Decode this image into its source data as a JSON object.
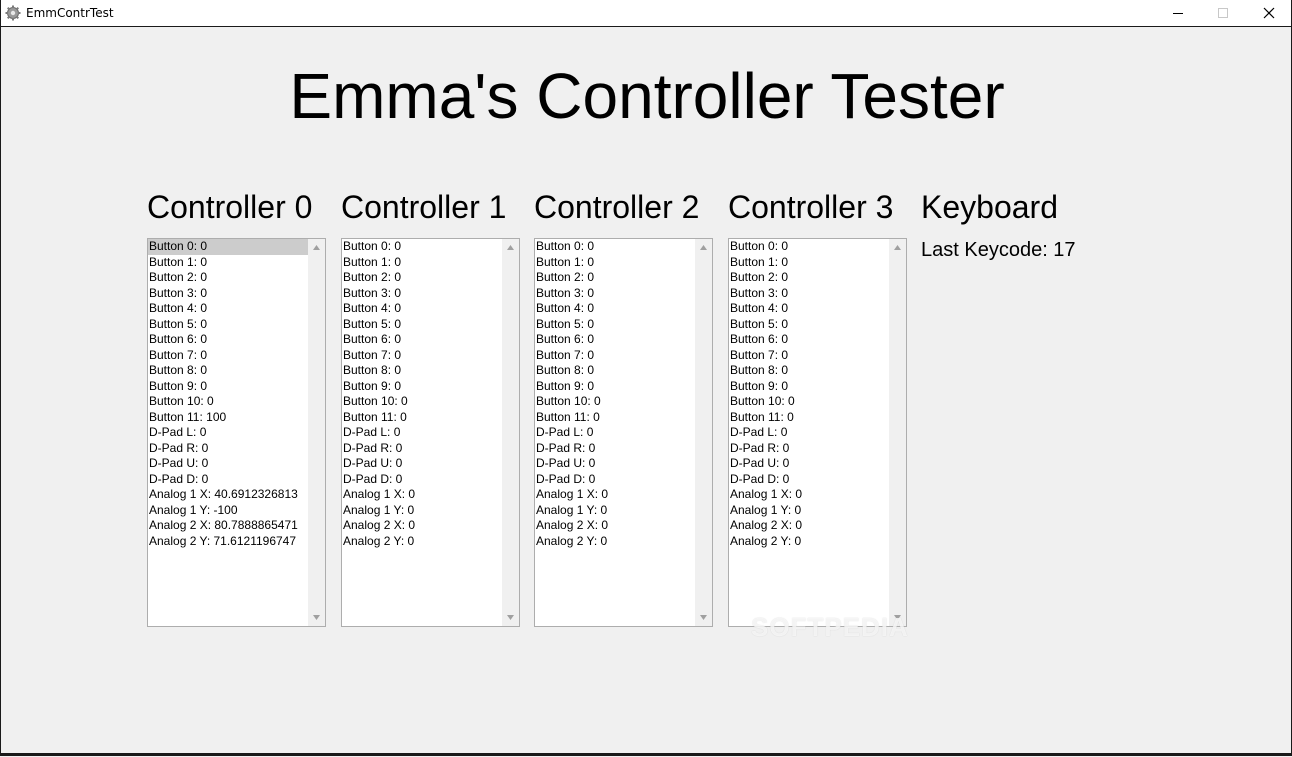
{
  "window": {
    "title": "EmmContrTest"
  },
  "main": {
    "heading": "Emma's Controller Tester"
  },
  "controllers": [
    {
      "title": "Controller 0",
      "selected_index": 0,
      "items": [
        "Button 0: 0",
        "Button 1: 0",
        "Button 2: 0",
        "Button 3: 0",
        "Button 4: 0",
        "Button 5: 0",
        "Button 6: 0",
        "Button 7: 0",
        "Button 8: 0",
        "Button 9: 0",
        "Button 10: 0",
        "Button 11: 100",
        "D-Pad L: 0",
        "D-Pad R: 0",
        "D-Pad U: 0",
        "D-Pad D: 0",
        "Analog 1 X: 40.6912326813",
        "Analog 1 Y: -100",
        "Analog 2 X: 80.7888865471",
        "Analog 2 Y: 71.6121196747"
      ]
    },
    {
      "title": "Controller 1",
      "items": [
        "Button 0: 0",
        "Button 1: 0",
        "Button 2: 0",
        "Button 3: 0",
        "Button 4: 0",
        "Button 5: 0",
        "Button 6: 0",
        "Button 7: 0",
        "Button 8: 0",
        "Button 9: 0",
        "Button 10: 0",
        "Button 11: 0",
        "D-Pad L: 0",
        "D-Pad R: 0",
        "D-Pad U: 0",
        "D-Pad D: 0",
        "Analog 1 X: 0",
        "Analog 1 Y: 0",
        "Analog 2 X: 0",
        "Analog 2 Y: 0"
      ]
    },
    {
      "title": "Controller 2",
      "items": [
        "Button 0: 0",
        "Button 1: 0",
        "Button 2: 0",
        "Button 3: 0",
        "Button 4: 0",
        "Button 5: 0",
        "Button 6: 0",
        "Button 7: 0",
        "Button 8: 0",
        "Button 9: 0",
        "Button 10: 0",
        "Button 11: 0",
        "D-Pad L: 0",
        "D-Pad R: 0",
        "D-Pad U: 0",
        "D-Pad D: 0",
        "Analog 1 X: 0",
        "Analog 1 Y: 0",
        "Analog 2 X: 0",
        "Analog 2 Y: 0"
      ]
    },
    {
      "title": "Controller 3",
      "items": [
        "Button 0: 0",
        "Button 1: 0",
        "Button 2: 0",
        "Button 3: 0",
        "Button 4: 0",
        "Button 5: 0",
        "Button 6: 0",
        "Button 7: 0",
        "Button 8: 0",
        "Button 9: 0",
        "Button 10: 0",
        "Button 11: 0",
        "D-Pad L: 0",
        "D-Pad R: 0",
        "D-Pad U: 0",
        "D-Pad D: 0",
        "Analog 1 X: 0",
        "Analog 1 Y: 0",
        "Analog 2 X: 0",
        "Analog 2 Y: 0"
      ]
    }
  ],
  "keyboard": {
    "title": "Keyboard",
    "last_keycode_label": "Last Keycode: 17"
  },
  "watermark": "SOFTPEDIA",
  "icons": {
    "app": "gear-icon",
    "minimize": "minimize-icon",
    "maximize": "maximize-icon",
    "close": "close-icon",
    "scroll_up": "scroll-up-arrow-icon",
    "scroll_down": "scroll-down-arrow-icon"
  }
}
